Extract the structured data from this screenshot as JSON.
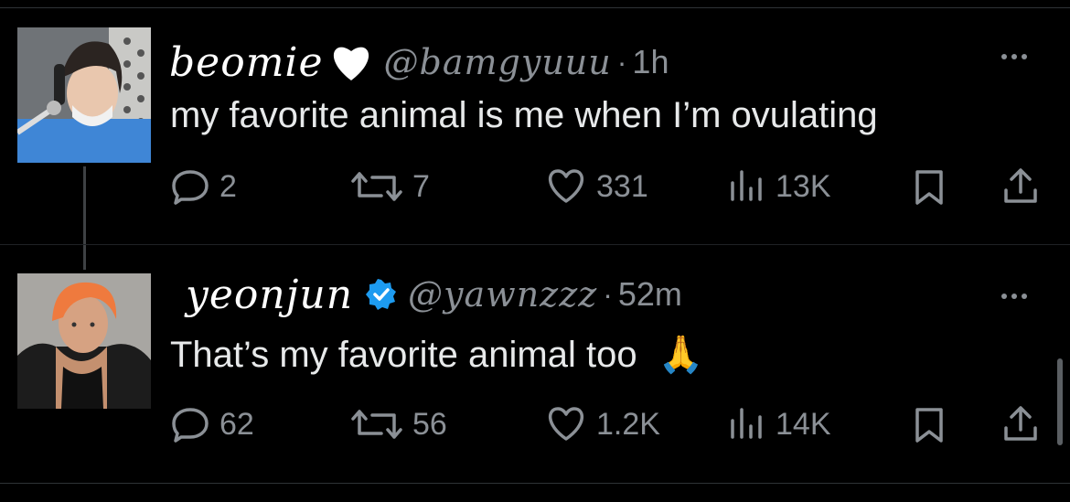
{
  "tweets": [
    {
      "display_name": "beomie",
      "badge": "white-heart",
      "handle": "@bamgyuuu",
      "separator": "·",
      "time": "1h",
      "text": "my favorite animal is me when I’m ovulating",
      "replies": "2",
      "retweets": "7",
      "likes": "331",
      "views": "13K"
    },
    {
      "display_name": "yeonjun",
      "badge": "verified-checkmark",
      "handle": "@yawnzzz",
      "separator": "·",
      "time": "52m",
      "text": "That’s my favorite animal too",
      "text_emoji": "🙏",
      "replies": "62",
      "retweets": "56",
      "likes": "1.2K",
      "views": "14K"
    }
  ],
  "colors": {
    "background": "#000000",
    "text": "#e7e9ea",
    "muted": "#8b9096",
    "verified": "#1d9bf0",
    "divider": "#2f3336"
  }
}
